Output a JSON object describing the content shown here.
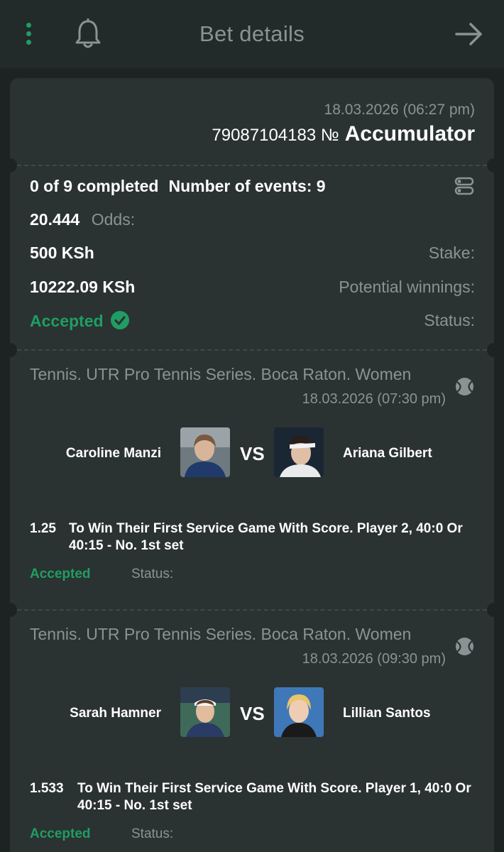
{
  "header": {
    "title": "Bet details",
    "menu_icon": "kebab-menu-icon",
    "bell_icon": "bell-icon",
    "forward_icon": "arrow-right-icon"
  },
  "bet": {
    "date": "18.03.2026 (06:27 pm)",
    "number": "79087104183 №",
    "type": "Accumulator",
    "completed": "0 of 9 completed",
    "events_count": "Number of events: 9",
    "odds_value": "20.444",
    "odds_label": "Odds:",
    "stake_value": "500 KSh",
    "stake_label": "Stake:",
    "winnings_value": "10222.09 KSh",
    "winnings_label": "Potential winnings:",
    "status_value": "Accepted",
    "status_label": "Status:"
  },
  "events": [
    {
      "league": "Tennis. UTR Pro Tennis Series. Boca Raton. Women",
      "date": "18.03.2026 (07:30 pm)",
      "player1": "Caroline Manzi",
      "player2": "Ariana Gilbert",
      "vs": "VS",
      "odds": "1.25",
      "pick": "To Win Their First Service Game With Score. Player 2, 40:0 Or 40:15 - No. 1st set",
      "status_value": "Accepted",
      "status_label": "Status:"
    },
    {
      "league": "Tennis. UTR Pro Tennis Series. Boca Raton. Women",
      "date": "18.03.2026 (09:30 pm)",
      "player1": "Sarah Hamner",
      "player2": "Lillian Santos",
      "vs": "VS",
      "odds": "1.533",
      "pick": "To Win Their First Service Game With Score. Player 1, 40:0 Or 40:15 - No. 1st set",
      "status_value": "Accepted",
      "status_label": "Status:"
    }
  ],
  "colors": {
    "background": "#1d2222",
    "card": "#2b3232",
    "accent_green": "#1f9d63",
    "muted_text": "#8a9393"
  }
}
